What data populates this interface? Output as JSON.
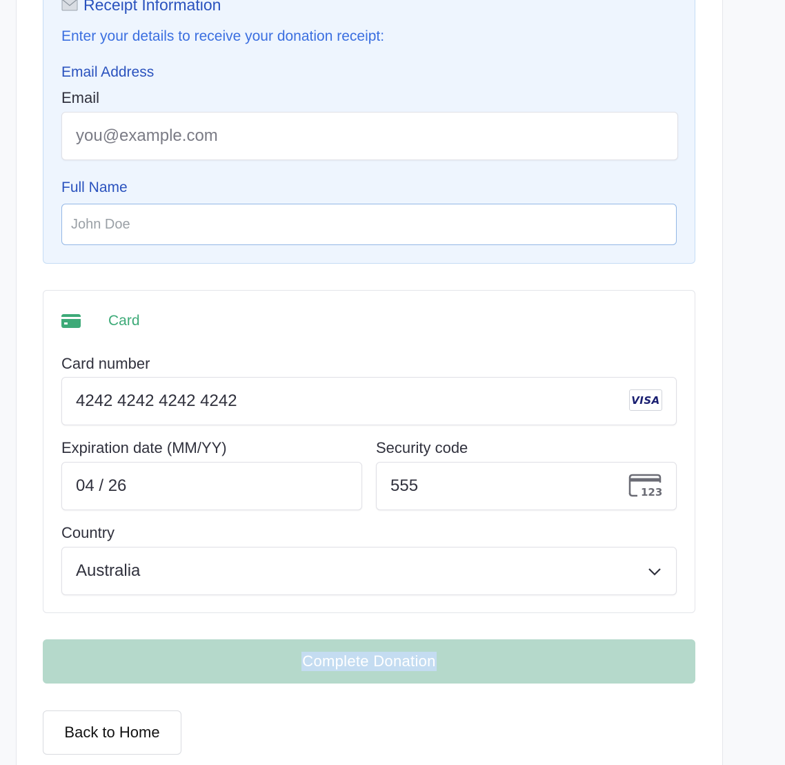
{
  "receipt": {
    "title": "Receipt Information",
    "intro": "Enter your details to receive your donation receipt:",
    "email_section_label": "Email Address",
    "email_label": "Email",
    "email_placeholder": "you@example.com",
    "name_label": "Full Name",
    "name_placeholder": "John Doe"
  },
  "payment": {
    "method_label": "Card",
    "method_icon": "credit-card-icon",
    "card_number_label": "Card number",
    "card_number_value": "4242 4242 4242 4242",
    "card_brand": "VISA",
    "expiry_label": "Expiration date (MM/YY)",
    "expiry_value": "04 / 26",
    "cvc_label": "Security code",
    "cvc_value": "555",
    "cvc_icon_text": "123",
    "country_label": "Country",
    "country_value": "Australia"
  },
  "actions": {
    "donate_label": "Complete Donation",
    "home_label": "Back to Home"
  },
  "colors": {
    "accent_blue": "#2a52be",
    "card_green": "#3daa78",
    "button_disabled": "#b5d9cb"
  }
}
